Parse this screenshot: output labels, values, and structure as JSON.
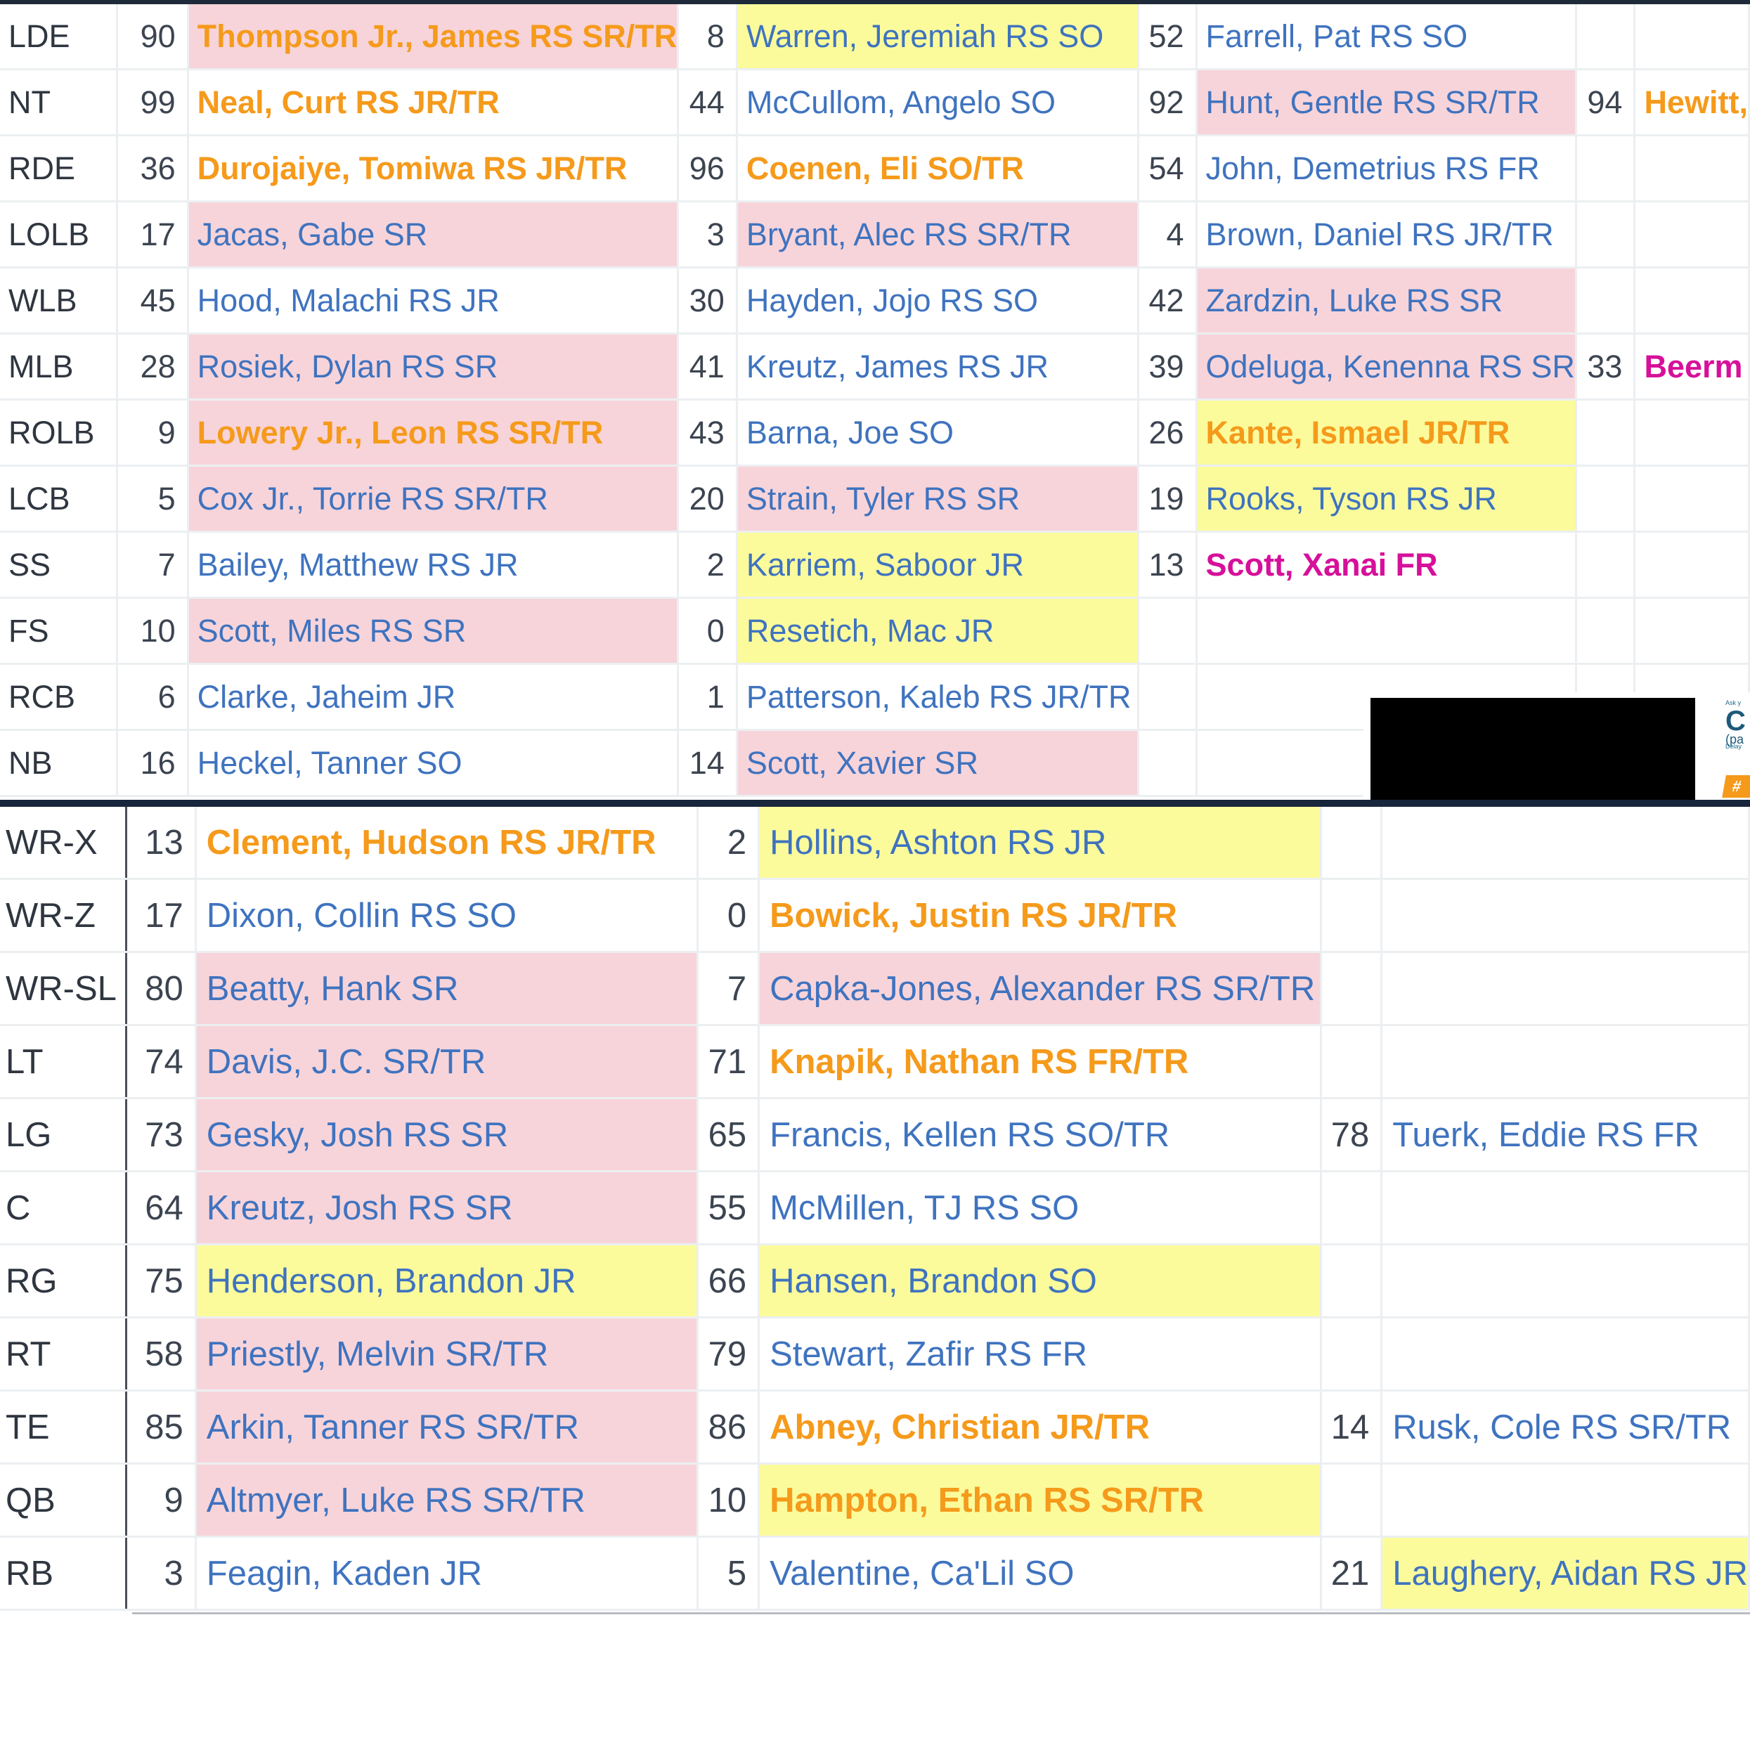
{
  "defense": {
    "rows": [
      {
        "pos": "LDE",
        "p": [
          {
            "n": "90",
            "name": "Thompson Jr., James RS SR/TR",
            "hl": "pink",
            "c": "orange"
          },
          {
            "n": "8",
            "name": "Warren, Jeremiah RS SO",
            "hl": "yellow"
          },
          {
            "n": "52",
            "name": "Farrell, Pat RS SO"
          },
          {
            "n": "",
            "name": ""
          }
        ]
      },
      {
        "pos": "NT",
        "p": [
          {
            "n": "99",
            "name": "Neal, Curt RS JR/TR",
            "c": "orange"
          },
          {
            "n": "44",
            "name": "McCullom, Angelo SO"
          },
          {
            "n": "92",
            "name": "Hunt, Gentle RS SR/TR",
            "hl": "pink"
          },
          {
            "n": "94",
            "name": "Hewitt,",
            "c": "orange"
          }
        ]
      },
      {
        "pos": "RDE",
        "p": [
          {
            "n": "36",
            "name": "Durojaiye, Tomiwa RS JR/TR",
            "c": "orange"
          },
          {
            "n": "96",
            "name": "Coenen, Eli SO/TR",
            "c": "orange"
          },
          {
            "n": "54",
            "name": "John, Demetrius RS FR"
          },
          {
            "n": "",
            "name": ""
          }
        ]
      },
      {
        "pos": "LOLB",
        "p": [
          {
            "n": "17",
            "name": "Jacas, Gabe SR",
            "hl": "pink"
          },
          {
            "n": "3",
            "name": "Bryant, Alec RS SR/TR",
            "hl": "pink"
          },
          {
            "n": "4",
            "name": "Brown, Daniel RS JR/TR"
          },
          {
            "n": "",
            "name": ""
          }
        ]
      },
      {
        "pos": "WLB",
        "p": [
          {
            "n": "45",
            "name": "Hood, Malachi RS JR"
          },
          {
            "n": "30",
            "name": "Hayden, Jojo RS SO"
          },
          {
            "n": "42",
            "name": "Zardzin, Luke RS SR",
            "hl": "pink"
          },
          {
            "n": "",
            "name": ""
          }
        ]
      },
      {
        "pos": "MLB",
        "p": [
          {
            "n": "28",
            "name": "Rosiek, Dylan RS SR",
            "hl": "pink"
          },
          {
            "n": "41",
            "name": "Kreutz, James RS JR"
          },
          {
            "n": "39",
            "name": "Odeluga, Kenenna RS SR",
            "hl": "pink"
          },
          {
            "n": "33",
            "name": "Beerm",
            "c": "magenta"
          }
        ]
      },
      {
        "pos": "ROLB",
        "p": [
          {
            "n": "9",
            "name": "Lowery Jr., Leon RS SR/TR",
            "hl": "pink",
            "c": "orange"
          },
          {
            "n": "43",
            "name": "Barna, Joe SO"
          },
          {
            "n": "26",
            "name": "Kante, Ismael JR/TR",
            "hl": "yellow",
            "c": "orange"
          },
          {
            "n": "",
            "name": ""
          }
        ]
      },
      {
        "pos": "LCB",
        "p": [
          {
            "n": "5",
            "name": "Cox Jr., Torrie RS SR/TR",
            "hl": "pink"
          },
          {
            "n": "20",
            "name": "Strain, Tyler RS SR",
            "hl": "pink"
          },
          {
            "n": "19",
            "name": "Rooks, Tyson RS JR",
            "hl": "yellow"
          },
          {
            "n": "",
            "name": ""
          }
        ]
      },
      {
        "pos": "SS",
        "p": [
          {
            "n": "7",
            "name": "Bailey, Matthew RS JR"
          },
          {
            "n": "2",
            "name": "Karriem, Saboor JR",
            "hl": "yellow"
          },
          {
            "n": "13",
            "name": "Scott, Xanai FR",
            "c": "magenta"
          },
          {
            "n": "",
            "name": ""
          }
        ]
      },
      {
        "pos": "FS",
        "p": [
          {
            "n": "10",
            "name": "Scott, Miles RS SR",
            "hl": "pink"
          },
          {
            "n": "0",
            "name": "Resetich, Mac JR",
            "hl": "yellow"
          },
          {
            "n": "",
            "name": ""
          },
          {
            "n": "",
            "name": ""
          }
        ]
      },
      {
        "pos": "RCB",
        "p": [
          {
            "n": "6",
            "name": "Clarke, Jaheim JR"
          },
          {
            "n": "1",
            "name": "Patterson, Kaleb RS JR/TR"
          },
          {
            "n": "",
            "name": ""
          },
          {
            "n": "",
            "name": ""
          }
        ]
      },
      {
        "pos": "NB",
        "p": [
          {
            "n": "16",
            "name": "Heckel, Tanner SO"
          },
          {
            "n": "14",
            "name": "Scott, Xavier SR",
            "hl": "pink"
          },
          {
            "n": "",
            "name": ""
          },
          {
            "n": "",
            "name": ""
          }
        ]
      }
    ]
  },
  "offense": {
    "rows": [
      {
        "pos": "WR-X",
        "p": [
          {
            "n": "13",
            "name": "Clement, Hudson RS JR/TR",
            "c": "orange"
          },
          {
            "n": "2",
            "name": "Hollins, Ashton RS JR",
            "hl": "yellow"
          },
          {
            "n": "",
            "name": ""
          }
        ]
      },
      {
        "pos": "WR-Z",
        "p": [
          {
            "n": "17",
            "name": "Dixon, Collin RS SO"
          },
          {
            "n": "0",
            "name": "Bowick, Justin RS JR/TR",
            "c": "orange"
          },
          {
            "n": "",
            "name": ""
          }
        ]
      },
      {
        "pos": "WR-SL",
        "p": [
          {
            "n": "80",
            "name": "Beatty, Hank SR",
            "hl": "pink"
          },
          {
            "n": "7",
            "name": "Capka-Jones, Alexander RS SR/TR",
            "hl": "pink"
          },
          {
            "n": "",
            "name": ""
          }
        ]
      },
      {
        "pos": "LT",
        "p": [
          {
            "n": "74",
            "name": "Davis, J.C. SR/TR",
            "hl": "pink"
          },
          {
            "n": "71",
            "name": "Knapik, Nathan RS FR/TR",
            "c": "orange"
          },
          {
            "n": "",
            "name": ""
          }
        ]
      },
      {
        "pos": "LG",
        "p": [
          {
            "n": "73",
            "name": "Gesky, Josh RS SR",
            "hl": "pink"
          },
          {
            "n": "65",
            "name": "Francis, Kellen RS SO/TR"
          },
          {
            "n": "78",
            "name": "Tuerk, Eddie RS FR"
          }
        ]
      },
      {
        "pos": "C",
        "p": [
          {
            "n": "64",
            "name": "Kreutz, Josh RS SR",
            "hl": "pink"
          },
          {
            "n": "55",
            "name": "McMillen, TJ RS SO"
          },
          {
            "n": "",
            "name": ""
          }
        ]
      },
      {
        "pos": "RG",
        "p": [
          {
            "n": "75",
            "name": "Henderson, Brandon JR",
            "hl": "yellow"
          },
          {
            "n": "66",
            "name": "Hansen, Brandon SO",
            "hl": "yellow"
          },
          {
            "n": "",
            "name": ""
          }
        ]
      },
      {
        "pos": "RT",
        "p": [
          {
            "n": "58",
            "name": "Priestly, Melvin SR/TR",
            "hl": "pink"
          },
          {
            "n": "79",
            "name": "Stewart, Zafir RS FR"
          },
          {
            "n": "",
            "name": ""
          }
        ]
      },
      {
        "pos": "TE",
        "p": [
          {
            "n": "85",
            "name": "Arkin, Tanner RS SR/TR",
            "hl": "pink"
          },
          {
            "n": "86",
            "name": "Abney, Christian JR/TR",
            "c": "orange"
          },
          {
            "n": "14",
            "name": "Rusk, Cole RS SR/TR"
          }
        ]
      },
      {
        "pos": "QB",
        "p": [
          {
            "n": "9",
            "name": "Altmyer, Luke RS SR/TR",
            "hl": "pink"
          },
          {
            "n": "10",
            "name": "Hampton, Ethan RS SR/TR",
            "hl": "yellow",
            "c": "orange"
          },
          {
            "n": "",
            "name": ""
          }
        ]
      },
      {
        "pos": "RB",
        "p": [
          {
            "n": "3",
            "name": "Feagin, Kaden JR"
          },
          {
            "n": "5",
            "name": "Valentine, Ca'Lil SO"
          },
          {
            "n": "21",
            "name": "Laughery, Aidan RS JR",
            "hl": "yellow"
          }
        ]
      }
    ]
  },
  "ad": {
    "line1": "Ask y",
    "big": "C",
    "paren": "(pa",
    "small": "Delay",
    "badge": "#"
  },
  "colors": {
    "link_blue": "#3f73bf",
    "orange": "#f59a1b",
    "magenta": "#d6109a",
    "pink_fill": "#f7d4da",
    "yellow_fill": "#fbfb9c"
  }
}
